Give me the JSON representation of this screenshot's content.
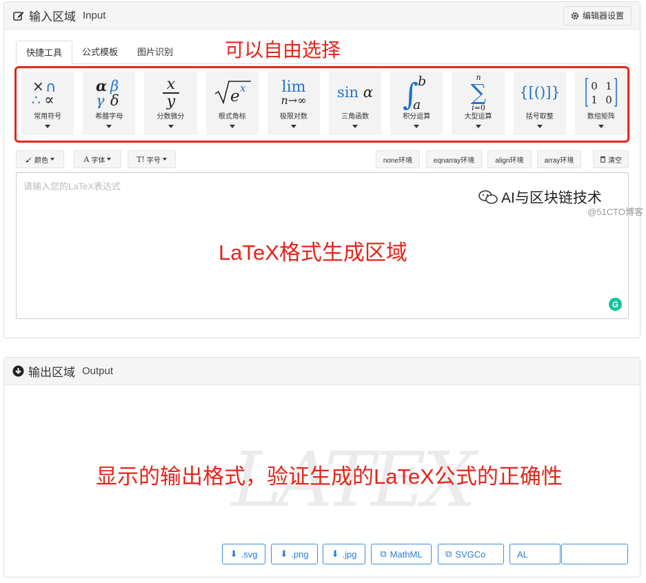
{
  "input_panel": {
    "title": "输入区域",
    "subtitle": "Input",
    "settings_label": "编辑器设置",
    "tabs": [
      {
        "label": "快捷工具",
        "active": true
      },
      {
        "label": "公式模板",
        "active": false
      },
      {
        "label": "图片识别",
        "active": false
      }
    ],
    "annotation_tools": "可以自由选择",
    "tools": [
      {
        "label": "常用符号",
        "icon": "common-symbols"
      },
      {
        "label": "希腊字母",
        "icon": "greek-letters"
      },
      {
        "label": "分数微分",
        "icon": "fraction"
      },
      {
        "label": "根式角标",
        "icon": "radical"
      },
      {
        "label": "极限对数",
        "icon": "limit"
      },
      {
        "label": "三角函数",
        "icon": "trig",
        "glyph": "sin α"
      },
      {
        "label": "积分运算",
        "icon": "integral"
      },
      {
        "label": "大型运算",
        "icon": "summation"
      },
      {
        "label": "括号取整",
        "icon": "brackets",
        "glyph": "{[()]}"
      },
      {
        "label": "数组矩阵",
        "icon": "matrix"
      }
    ],
    "format": {
      "color_label": "颜色",
      "font_label": "字体",
      "size_label": "字号",
      "env_none": "none环境",
      "env_eqnarray": "eqnarray环境",
      "env_align": "align环境",
      "env_array": "array环境",
      "clear_label": "清空"
    },
    "editor": {
      "placeholder": "请输入您的LaTeX表达式",
      "annotation": "LaTeX格式生成区域"
    }
  },
  "output_panel": {
    "title": "输出区域",
    "subtitle": "Output",
    "annotation": "显示的输出格式，验证生成的LaTeX公式的正确性",
    "downloads": [
      ".svg",
      ".png",
      ".jpg",
      "MathML",
      "SVGCo",
      "AL"
    ],
    "brand": "AI与区块链技术",
    "copyright": "@51CTO博客"
  },
  "colors": {
    "annotation_red": "#e5241b",
    "button_blue": "#2a7bd6",
    "grammarly_green": "#15c39a"
  }
}
